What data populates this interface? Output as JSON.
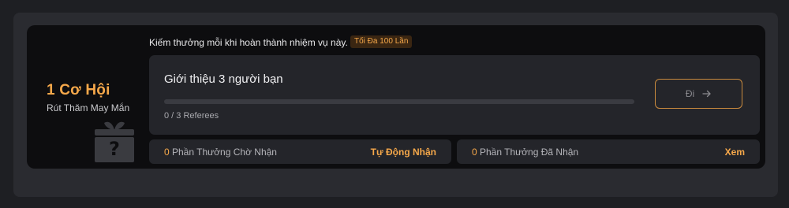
{
  "chances": {
    "title": "1 Cơ Hội",
    "subtitle": "Rút Thăm May Mắn",
    "icon": "mystery-gift-icon"
  },
  "description": "Kiếm thưởng mỗi khi hoàn thành nhiệm vụ này.",
  "limit_badge": "Tối Đa 100 Lần",
  "task": {
    "title": "Giới thiệu 3 người bạn",
    "progress_text": "0 / 3 Referees",
    "progress_fraction": 0,
    "go_label": "Đi",
    "go_icon": "arrow-right-icon"
  },
  "rewards": {
    "pending": {
      "count": "0",
      "label": "Phần Thưởng Chờ Nhận",
      "action": "Tự Động Nhận"
    },
    "claimed": {
      "count": "0",
      "label": "Phần Thưởng Đã Nhận",
      "action": "Xem"
    }
  },
  "colors": {
    "accent": "#f6a84a",
    "card_bg": "#0d0d0f",
    "panel_bg": "#24252a"
  }
}
